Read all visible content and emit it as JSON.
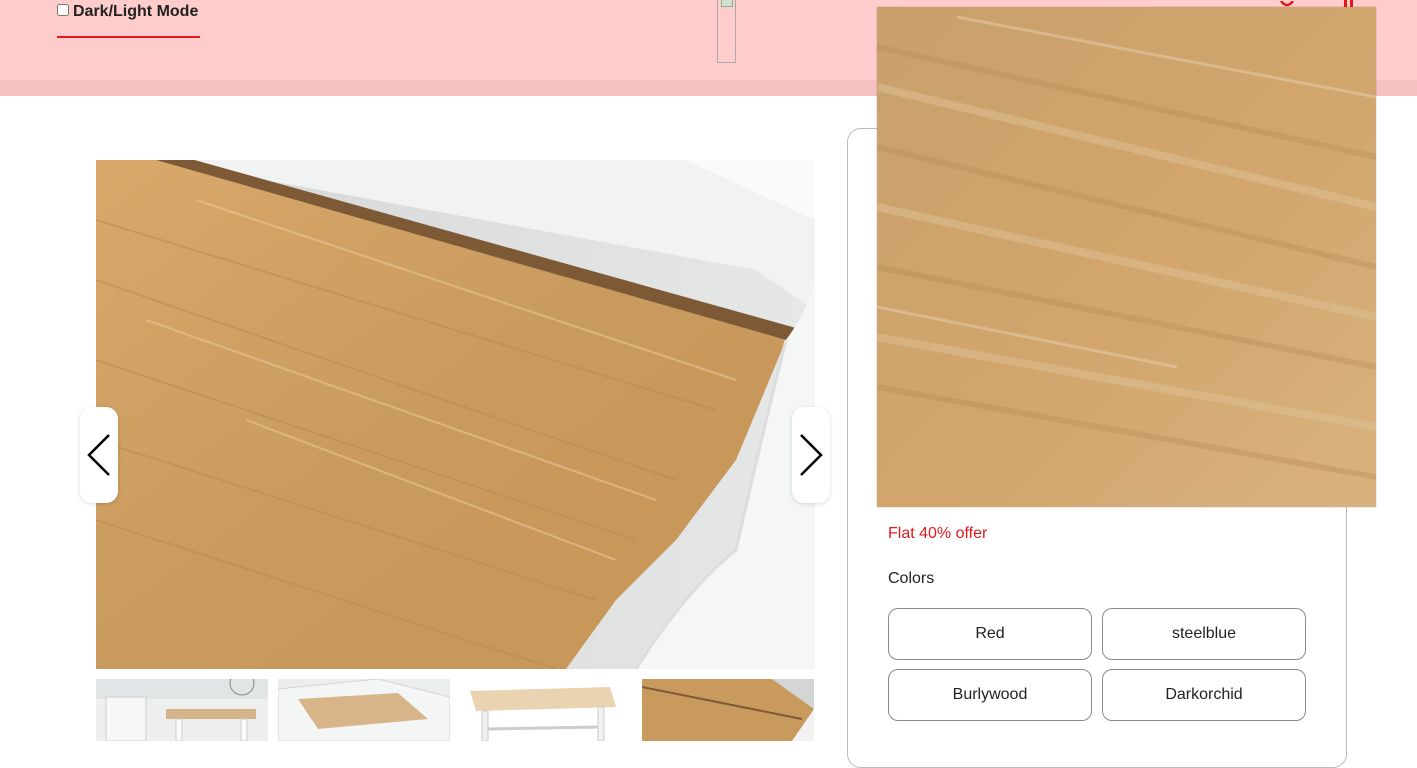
{
  "header": {
    "mode_toggle_label": "Dark/Light Mode",
    "background_color": "#ffcccc",
    "accent_color": "#e0191f"
  },
  "gallery": {
    "prev_label": "previous",
    "next_label": "next",
    "thumbnail_count": 4
  },
  "product": {
    "offer_text": "Flat 40% offer",
    "colors_label": "Colors",
    "colors": [
      "Red",
      "steelblue",
      "Burlywood",
      "Darkorchid"
    ]
  }
}
